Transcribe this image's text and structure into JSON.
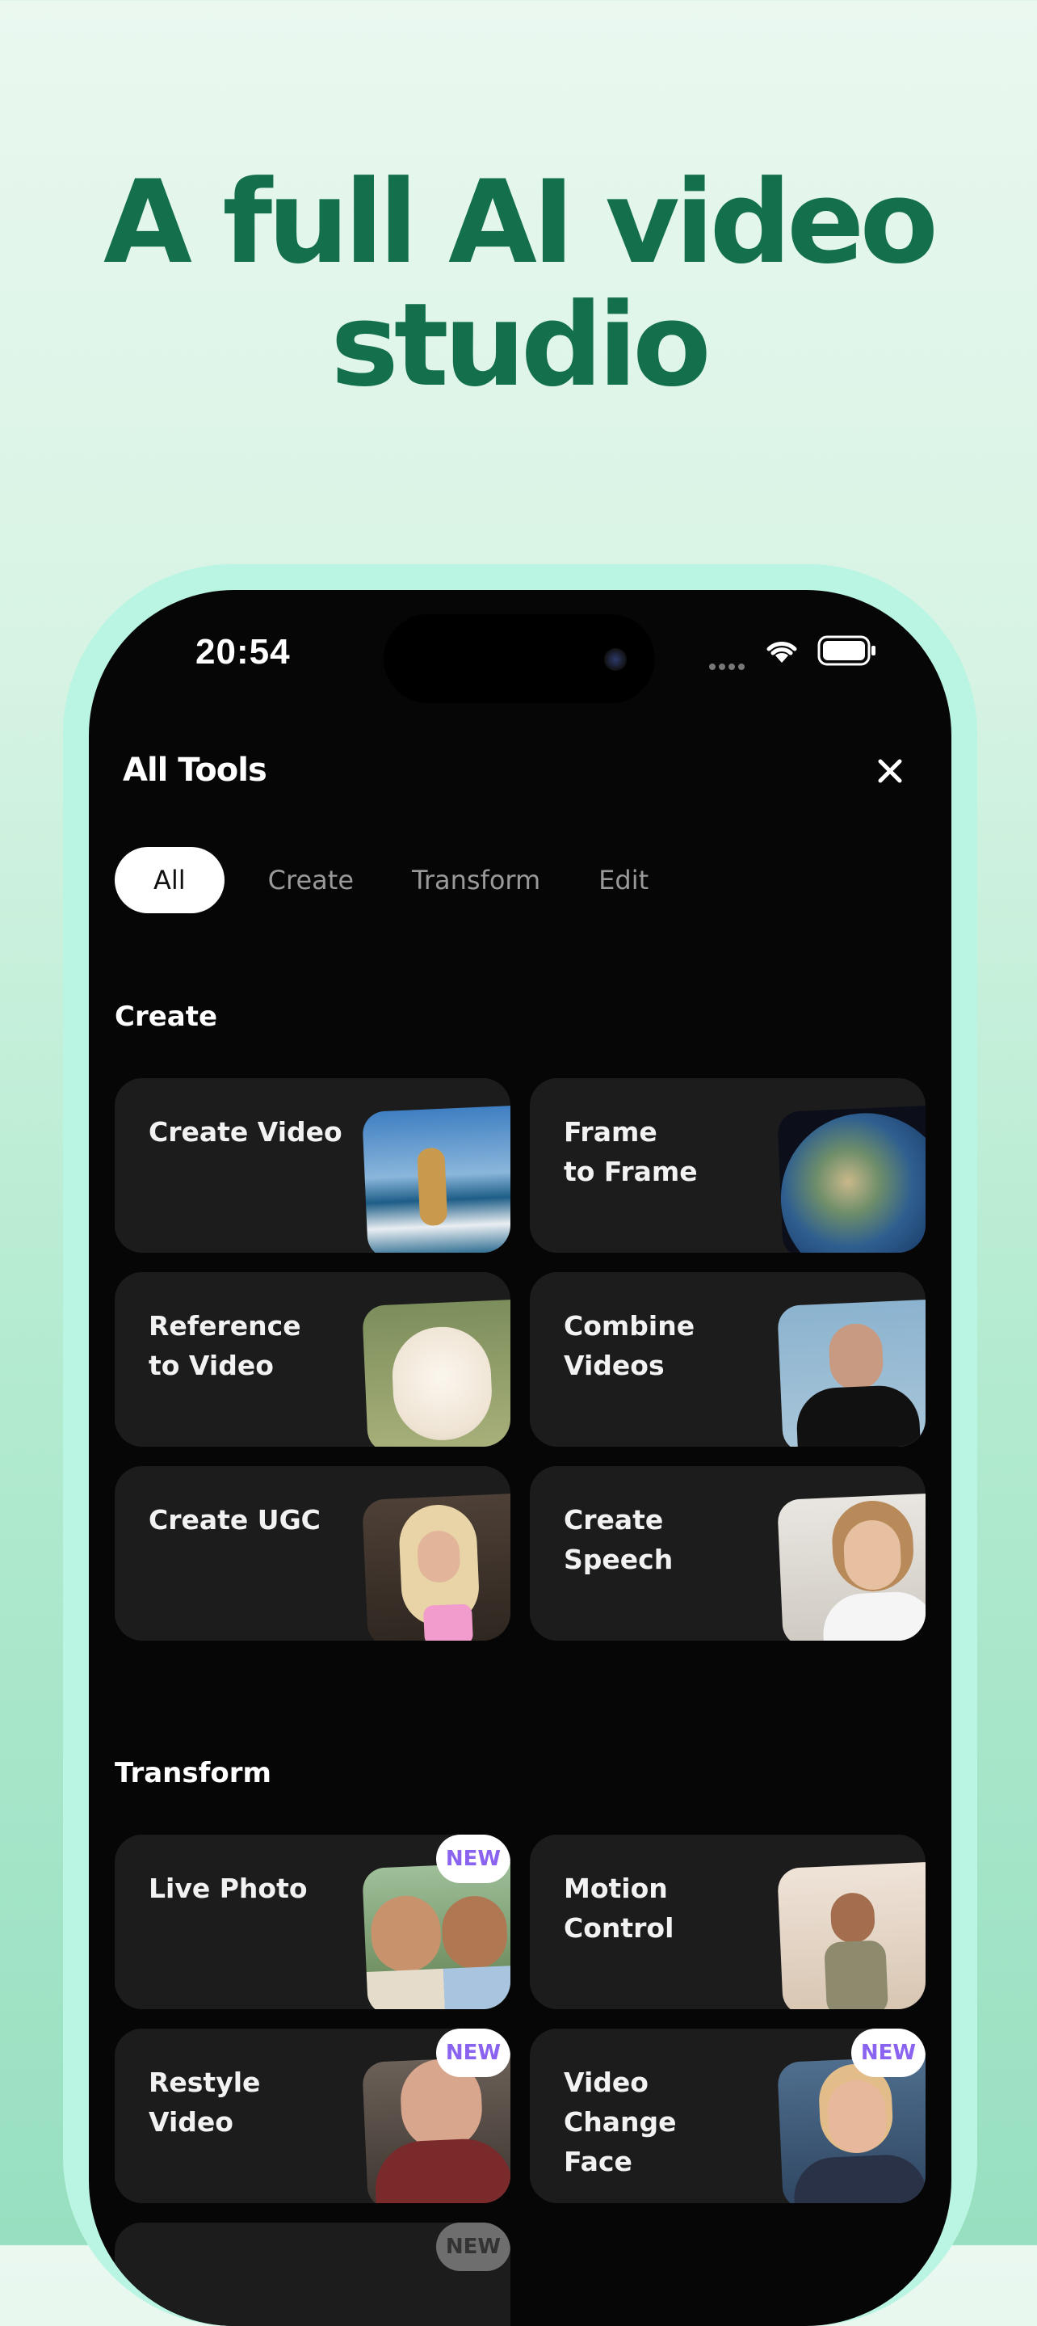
{
  "headline": {
    "line1": "A full AI video",
    "line2": "studio"
  },
  "status_bar": {
    "time": "20:54"
  },
  "sheet": {
    "title": "All Tools"
  },
  "tabs": [
    "All",
    "Create",
    "Transform",
    "Edit"
  ],
  "sections": {
    "create": "Create",
    "transform": "Transform"
  },
  "create_tools": [
    {
      "line1": "Create Video",
      "line2": ""
    },
    {
      "line1": "Frame",
      "line2": "to Frame"
    },
    {
      "line1": "Reference",
      "line2": "to Video"
    },
    {
      "line1": "Combine",
      "line2": "Videos"
    },
    {
      "line1": "Create UGC",
      "line2": ""
    },
    {
      "line1": "Create",
      "line2": "Speech"
    }
  ],
  "transform_tools": [
    {
      "line1": "Live Photo",
      "line2": "",
      "badge": "NEW"
    },
    {
      "line1": "Motion",
      "line2": "Control",
      "badge": ""
    },
    {
      "line1": "Restyle Video",
      "line2": "",
      "badge": "NEW"
    },
    {
      "line1": "Video Change",
      "line2": "Face",
      "badge": "NEW"
    },
    {
      "line1": "",
      "line2": "",
      "badge": "NEW"
    }
  ],
  "colors": {
    "brand_green": "#14704c",
    "frame_mint": "#b9f5e2",
    "badge_purple": "#8a63f0",
    "card_bg": "#1c1c1c"
  }
}
